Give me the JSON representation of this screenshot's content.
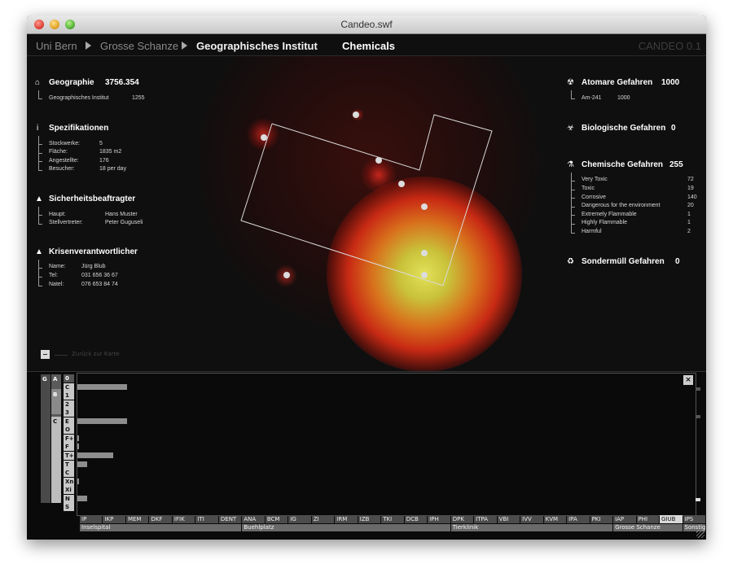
{
  "window": {
    "title": "Candeo.swf"
  },
  "nav": {
    "crumbs": [
      "Uni Bern",
      "Grosse Schanze",
      "Geographisches Institut"
    ],
    "title": "Chemicals",
    "version": "CANDEO 0.1"
  },
  "left": {
    "geo": {
      "title": "Geographie",
      "value": "3756.354",
      "sub_label": "Geographisches Institut",
      "sub_value": "1255"
    },
    "spec": {
      "title": "Spezifikationen",
      "rows": [
        {
          "label": "Stockwerke:",
          "value": "5"
        },
        {
          "label": "Fläche:",
          "value": "1835 m2"
        },
        {
          "label": "Angestellte:",
          "value": "176"
        },
        {
          "label": "Besucher:",
          "value": "18 per day"
        }
      ]
    },
    "safety": {
      "title": "Sicherheitsbeaftragter",
      "rows": [
        {
          "label": "Haupt:",
          "value": "Hans Muster"
        },
        {
          "label": "Stellvertreter:",
          "value": "Peter Guguseli"
        }
      ]
    },
    "crisis": {
      "title": "Krisenverantwortlicher",
      "rows": [
        {
          "label": "Name:",
          "value": "Jürg Blub"
        },
        {
          "label": "Tel:",
          "value": "031 656 36 67"
        },
        {
          "label": "Natel:",
          "value": "076 653 84 74"
        }
      ]
    },
    "back_label": "Zurück zur Karte"
  },
  "right": {
    "atom": {
      "title": "Atomare Gefahren",
      "value": "1000",
      "rows": [
        {
          "label": "Am-241",
          "value": "1000"
        }
      ]
    },
    "bio": {
      "title": "Biologische Gefahren",
      "value": "0"
    },
    "chem": {
      "title": "Chemische Gefahren",
      "value": "255",
      "rows": [
        {
          "label": "Very Toxic",
          "value": "72"
        },
        {
          "label": "Toxic",
          "value": "19"
        },
        {
          "label": "Corrosive",
          "value": "140"
        },
        {
          "label": "Dangerous for the environment",
          "value": "20"
        },
        {
          "label": "Extremely Flammable",
          "value": "1"
        },
        {
          "label": "Highly Flammable",
          "value": "1"
        },
        {
          "label": "Harmful",
          "value": "2"
        }
      ]
    },
    "waste": {
      "title": "Sondermüll Gefahren",
      "value": "0"
    }
  },
  "matrix": {
    "col_g": "G",
    "col_a": "A",
    "col_b": "B",
    "col_c": "C",
    "cells": [
      "0",
      "C",
      "1",
      "2",
      "3",
      "E",
      "O",
      "F+",
      "F",
      "T+",
      "T",
      "C",
      "Xn",
      "Xi",
      "N",
      "S"
    ]
  },
  "chart_data": {
    "type": "bar",
    "categories": [
      "0",
      "C",
      "1",
      "2",
      "3",
      "E",
      "O",
      "F+",
      "F",
      "T+",
      "T",
      "C",
      "Xn",
      "Xi",
      "N",
      "S"
    ],
    "values": [
      0,
      140,
      0,
      0,
      0,
      140,
      0,
      1,
      1,
      101,
      27,
      0,
      2,
      0,
      28,
      0
    ],
    "xlim": [
      0,
      1000
    ]
  },
  "tabs": [
    "IP",
    "IKP",
    "MEM",
    "DKF",
    "IFIK",
    "ITI",
    "DENT",
    "ANA",
    "BCM",
    "IG",
    "ZI",
    "IRM",
    "IZB",
    "TKI",
    "DCB",
    "IPH",
    "DPK",
    "ITPA",
    "VBI",
    "IVV",
    "KVM",
    "IPA",
    "PKI",
    "IAP",
    "PHI",
    "GIUB",
    "IPS"
  ],
  "selected_tab": "GIUB",
  "areas": [
    "Inselspital",
    "Buehlplatz",
    "Tierklinik",
    "Grosse Schanze",
    "Sonstige"
  ],
  "colors": {
    "hazard_core": "#e0e040",
    "hazard_mid": "#d03010",
    "accent": "#ffffff"
  }
}
